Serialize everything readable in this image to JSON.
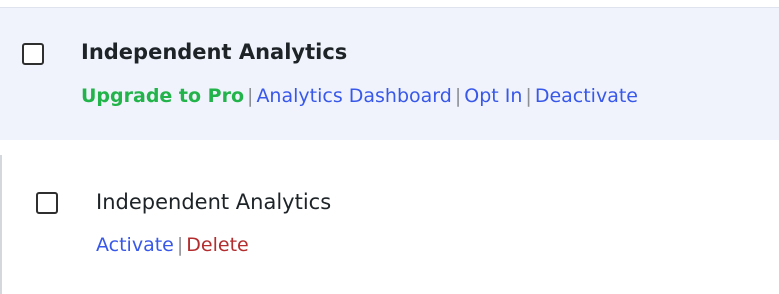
{
  "active_plugin": {
    "name": "Independent Analytics",
    "actions": {
      "upgrade": "Upgrade to Pro",
      "dashboard": "Analytics Dashboard",
      "opt_in": "Opt In",
      "deactivate": "Deactivate"
    },
    "separator": "|"
  },
  "inactive_plugin": {
    "name": "Independent Analytics",
    "actions": {
      "activate": "Activate",
      "delete": "Delete"
    },
    "separator": "|"
  },
  "colors": {
    "active_row_bg": "#f0f3fc",
    "link_blue": "#3858e9",
    "link_green": "#22b34a",
    "link_red": "#b32d2e"
  }
}
